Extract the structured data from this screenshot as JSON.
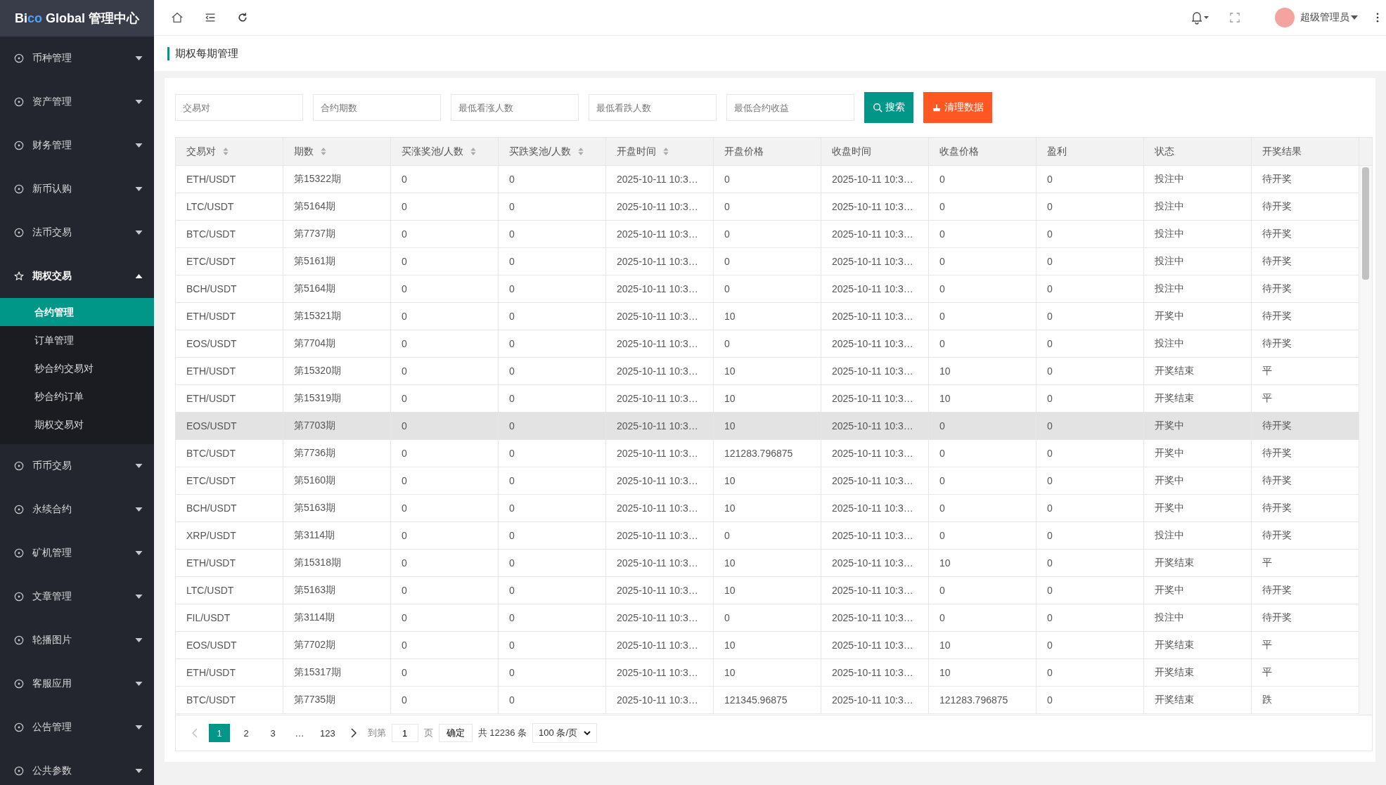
{
  "logo": [
    {
      "text": "Bi",
      "accent": false
    },
    {
      "text": "co",
      "accent": true
    },
    {
      "text": " Global 管理中心",
      "accent": false
    }
  ],
  "sidebar": {
    "items": [
      {
        "label": "币种管理",
        "expanded": false
      },
      {
        "label": "资产管理",
        "expanded": false
      },
      {
        "label": "财务管理",
        "expanded": false
      },
      {
        "label": "新币认购",
        "expanded": false
      },
      {
        "label": "法币交易",
        "expanded": false
      },
      {
        "label": "期权交易",
        "expanded": true,
        "children": [
          {
            "label": "合约管理",
            "selected": true
          },
          {
            "label": "订单管理",
            "selected": false
          },
          {
            "label": "秒合约交易对",
            "selected": false
          },
          {
            "label": "秒合约订单",
            "selected": false
          },
          {
            "label": "期权交易对",
            "selected": false
          }
        ]
      },
      {
        "label": "币币交易",
        "expanded": false
      },
      {
        "label": "永续合约",
        "expanded": false
      },
      {
        "label": "矿机管理",
        "expanded": false
      },
      {
        "label": "文章管理",
        "expanded": false
      },
      {
        "label": "轮播图片",
        "expanded": false
      },
      {
        "label": "客服应用",
        "expanded": false
      },
      {
        "label": "公告管理",
        "expanded": false
      },
      {
        "label": "公共参数",
        "expanded": false
      }
    ]
  },
  "header": {
    "user": "超级管理员"
  },
  "page_title": "期权每期管理",
  "filters": [
    {
      "placeholder": "交易对"
    },
    {
      "placeholder": "合约期数"
    },
    {
      "placeholder": "最低看涨人数"
    },
    {
      "placeholder": "最低看跌人数"
    },
    {
      "placeholder": "最低合约收益"
    }
  ],
  "buttons": [
    {
      "label": "搜索",
      "kind": "search"
    },
    {
      "label": "清理数据",
      "kind": "clear"
    }
  ],
  "table": {
    "columns": [
      {
        "label": "交易对",
        "sortable": true
      },
      {
        "label": "期数",
        "sortable": true
      },
      {
        "label": "买涨奖池/人数",
        "sortable": true
      },
      {
        "label": "买跌奖池/人数",
        "sortable": true
      },
      {
        "label": "开盘时间",
        "sortable": true
      },
      {
        "label": "开盘价格",
        "sortable": false
      },
      {
        "label": "收盘时间",
        "sortable": false
      },
      {
        "label": "收盘价格",
        "sortable": false
      },
      {
        "label": "盈利",
        "sortable": false
      },
      {
        "label": "状态",
        "sortable": false
      },
      {
        "label": "开奖结果",
        "sortable": false
      }
    ],
    "rows": [
      {
        "selected": false,
        "cells": [
          "ETH/USDT",
          "第15322期",
          "0",
          "0",
          "2025-10-11 10:3…",
          "0",
          "2025-10-11 10:3…",
          "0",
          "0",
          "投注中",
          "待开奖"
        ]
      },
      {
        "selected": false,
        "cells": [
          "LTC/USDT",
          "第5164期",
          "0",
          "0",
          "2025-10-11 10:3…",
          "0",
          "2025-10-11 10:3…",
          "0",
          "0",
          "投注中",
          "待开奖"
        ]
      },
      {
        "selected": false,
        "cells": [
          "BTC/USDT",
          "第7737期",
          "0",
          "0",
          "2025-10-11 10:3…",
          "0",
          "2025-10-11 10:3…",
          "0",
          "0",
          "投注中",
          "待开奖"
        ]
      },
      {
        "selected": false,
        "cells": [
          "ETC/USDT",
          "第5161期",
          "0",
          "0",
          "2025-10-11 10:3…",
          "0",
          "2025-10-11 10:3…",
          "0",
          "0",
          "投注中",
          "待开奖"
        ]
      },
      {
        "selected": false,
        "cells": [
          "BCH/USDT",
          "第5164期",
          "0",
          "0",
          "2025-10-11 10:3…",
          "0",
          "2025-10-11 10:3…",
          "0",
          "0",
          "投注中",
          "待开奖"
        ]
      },
      {
        "selected": false,
        "cells": [
          "ETH/USDT",
          "第15321期",
          "0",
          "0",
          "2025-10-11 10:3…",
          "10",
          "2025-10-11 10:3…",
          "0",
          "0",
          "开奖中",
          "待开奖"
        ]
      },
      {
        "selected": false,
        "cells": [
          "EOS/USDT",
          "第7704期",
          "0",
          "0",
          "2025-10-11 10:3…",
          "0",
          "2025-10-11 10:3…",
          "0",
          "0",
          "投注中",
          "待开奖"
        ]
      },
      {
        "selected": false,
        "cells": [
          "ETH/USDT",
          "第15320期",
          "0",
          "0",
          "2025-10-11 10:3…",
          "10",
          "2025-10-11 10:3…",
          "10",
          "0",
          "开奖结束",
          "平"
        ]
      },
      {
        "selected": false,
        "cells": [
          "ETH/USDT",
          "第15319期",
          "0",
          "0",
          "2025-10-11 10:3…",
          "10",
          "2025-10-11 10:3…",
          "10",
          "0",
          "开奖结束",
          "平"
        ]
      },
      {
        "selected": true,
        "cells": [
          "EOS/USDT",
          "第7703期",
          "0",
          "0",
          "2025-10-11 10:3…",
          "10",
          "2025-10-11 10:3…",
          "0",
          "0",
          "开奖中",
          "待开奖"
        ]
      },
      {
        "selected": false,
        "cells": [
          "BTC/USDT",
          "第7736期",
          "0",
          "0",
          "2025-10-11 10:3…",
          "121283.796875",
          "2025-10-11 10:3…",
          "0",
          "0",
          "开奖中",
          "待开奖"
        ]
      },
      {
        "selected": false,
        "cells": [
          "ETC/USDT",
          "第5160期",
          "0",
          "0",
          "2025-10-11 10:3…",
          "10",
          "2025-10-11 10:3…",
          "0",
          "0",
          "开奖中",
          "待开奖"
        ]
      },
      {
        "selected": false,
        "cells": [
          "BCH/USDT",
          "第5163期",
          "0",
          "0",
          "2025-10-11 10:3…",
          "10",
          "2025-10-11 10:3…",
          "0",
          "0",
          "开奖中",
          "待开奖"
        ]
      },
      {
        "selected": false,
        "cells": [
          "XRP/USDT",
          "第3114期",
          "0",
          "0",
          "2025-10-11 10:3…",
          "0",
          "2025-10-11 10:3…",
          "0",
          "0",
          "投注中",
          "待开奖"
        ]
      },
      {
        "selected": false,
        "cells": [
          "ETH/USDT",
          "第15318期",
          "0",
          "0",
          "2025-10-11 10:3…",
          "10",
          "2025-10-11 10:3…",
          "10",
          "0",
          "开奖结束",
          "平"
        ]
      },
      {
        "selected": false,
        "cells": [
          "LTC/USDT",
          "第5163期",
          "0",
          "0",
          "2025-10-11 10:3…",
          "10",
          "2025-10-11 10:3…",
          "0",
          "0",
          "开奖中",
          "待开奖"
        ]
      },
      {
        "selected": false,
        "cells": [
          "FIL/USDT",
          "第3114期",
          "0",
          "0",
          "2025-10-11 10:3…",
          "0",
          "2025-10-11 10:3…",
          "0",
          "0",
          "投注中",
          "待开奖"
        ]
      },
      {
        "selected": false,
        "cells": [
          "EOS/USDT",
          "第7702期",
          "0",
          "0",
          "2025-10-11 10:3…",
          "10",
          "2025-10-11 10:3…",
          "10",
          "0",
          "开奖结束",
          "平"
        ]
      },
      {
        "selected": false,
        "cells": [
          "ETH/USDT",
          "第15317期",
          "0",
          "0",
          "2025-10-11 10:3…",
          "10",
          "2025-10-11 10:3…",
          "10",
          "0",
          "开奖结束",
          "平"
        ]
      },
      {
        "selected": false,
        "cells": [
          "BTC/USDT",
          "第7735期",
          "0",
          "0",
          "2025-10-11 10:3…",
          "121345.96875",
          "2025-10-11 10:3…",
          "121283.796875",
          "0",
          "开奖结束",
          "跌"
        ]
      }
    ]
  },
  "pagination": {
    "pages": [
      {
        "label": "1",
        "selected": true
      },
      {
        "label": "2",
        "selected": false
      },
      {
        "label": "3",
        "selected": false
      },
      {
        "label": "…",
        "selected": false
      },
      {
        "label": "123",
        "selected": false
      }
    ],
    "goto_label": "到第",
    "goto_value": "1",
    "page_unit": "页",
    "confirm": "确定",
    "total": "共 12236 条",
    "page_size": "100 条/页"
  }
}
